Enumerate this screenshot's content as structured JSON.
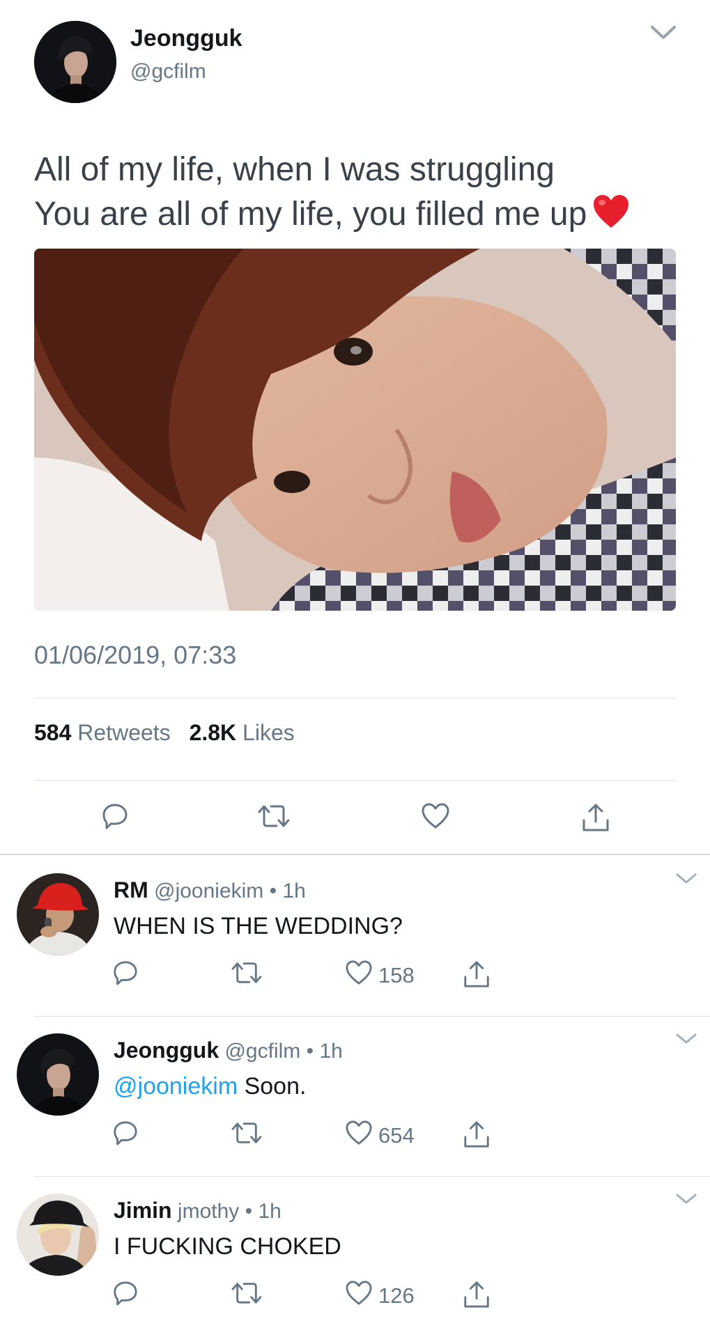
{
  "tweet": {
    "author_name": "Jeongguk",
    "author_handle": "@gcfilm",
    "text_lines": [
      "All of my life, when I was struggling",
      "You are all of my life, you filled me up"
    ],
    "emoji": "heart-emoji",
    "timestamp": "01/06/2019, 07:33",
    "retweet_count": "584",
    "retweet_label": "Retweets",
    "like_count": "2.8K",
    "like_label": "Likes",
    "actions": [
      "reply-icon",
      "retweet-icon",
      "like-icon",
      "share-icon"
    ]
  },
  "replies": [
    {
      "name": "RM",
      "handle": "@jooniekim",
      "dot": "•",
      "time": "1h",
      "text": "WHEN IS THE WEDDING?",
      "mention": "",
      "like_count": "158"
    },
    {
      "name": "Jeongguk",
      "handle": "@gcfilm",
      "dot": "•",
      "time": "1h",
      "mention": "@jooniekim",
      "text": " Soon.",
      "like_count": "654"
    },
    {
      "name": "Jimin",
      "handle": "jmothy",
      "dot": "•",
      "time": "1h",
      "text": "I FUCKING CHOKED",
      "mention": "",
      "like_count": "126"
    }
  ],
  "colors": {
    "link": "#1da1f2",
    "muted": "#657786",
    "heart": "#e0245e",
    "divider": "#dde1e5"
  }
}
